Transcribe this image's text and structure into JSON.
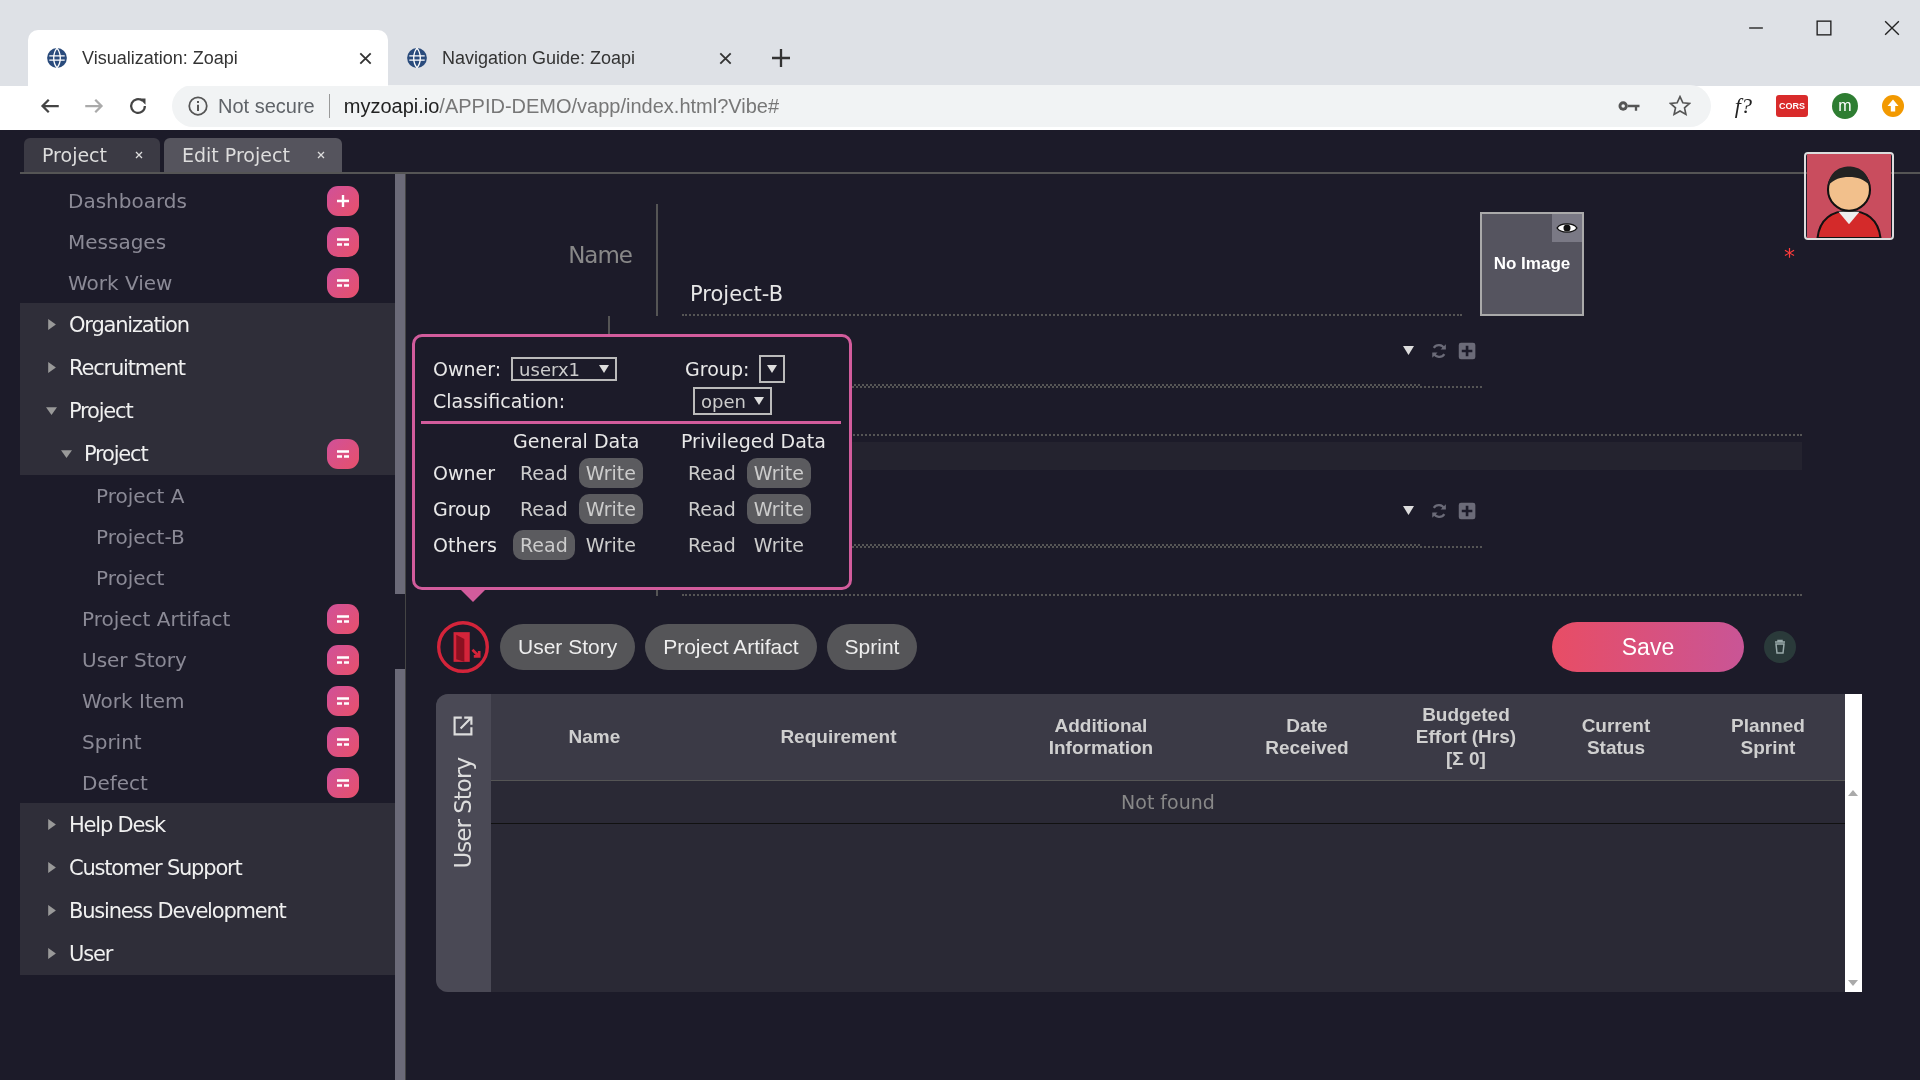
{
  "browser": {
    "tabs": [
      {
        "title": "Visualization: Zoapi",
        "selected": true
      },
      {
        "title": "Navigation Guide: Zoapi",
        "selected": false
      }
    ],
    "security": "Not secure",
    "url_host": "myzoapi.io",
    "url_path": "/APPID-DEMO/vapp/index.html?Vibe#",
    "function_label": "f?",
    "extension_label": "CORS",
    "profile_initial": "m"
  },
  "app_tabs": [
    {
      "label": "Project",
      "selected": false
    },
    {
      "label": "Edit Project",
      "selected": true
    }
  ],
  "sidebar": {
    "items": [
      {
        "kind": "link",
        "label": "Dashboards",
        "button": {
          "kind": "add"
        }
      },
      {
        "kind": "link",
        "label": "Messages",
        "button": {
          "kind": "menu"
        }
      },
      {
        "kind": "link",
        "label": "Work View",
        "button": {
          "kind": "menu"
        }
      },
      {
        "kind": "group",
        "label": "Organization",
        "expanded": false
      },
      {
        "kind": "group",
        "label": "Recruitment",
        "expanded": false
      },
      {
        "kind": "group",
        "label": "Project",
        "expanded": true,
        "children": [
          {
            "kind": "group",
            "label": "Project",
            "expanded": true,
            "button": {
              "kind": "menu"
            },
            "children": [
              {
                "label": "Project A"
              },
              {
                "label": "Project-B"
              },
              {
                "label": "Project"
              }
            ]
          },
          {
            "kind": "link",
            "label": "Project Artifact",
            "button": {
              "kind": "menu"
            }
          },
          {
            "kind": "link",
            "label": "User Story",
            "button": {
              "kind": "menu"
            }
          },
          {
            "kind": "link",
            "label": "Work Item",
            "button": {
              "kind": "menu"
            }
          },
          {
            "kind": "link",
            "label": "Sprint",
            "button": {
              "kind": "menu"
            }
          },
          {
            "kind": "link",
            "label": "Defect",
            "button": {
              "kind": "menu"
            }
          }
        ]
      },
      {
        "kind": "group",
        "label": "Help Desk",
        "expanded": false
      },
      {
        "kind": "group",
        "label": "Customer Support",
        "expanded": false
      },
      {
        "kind": "group",
        "label": "Business Development",
        "expanded": false
      },
      {
        "kind": "group",
        "label": "User",
        "expanded": false
      }
    ]
  },
  "form": {
    "name_label": "Name",
    "name_value": "Project-B",
    "image_label": "No Image",
    "required_mark": "*",
    "rows": [
      {
        "kind": "lookup"
      },
      {
        "kind": "text"
      },
      {
        "kind": "band"
      },
      {
        "kind": "lookup"
      },
      {
        "kind": "text"
      }
    ]
  },
  "permissions_popup": {
    "owner_label": "Owner:",
    "owner_value": "userx1",
    "group_label": "Group:",
    "classification_label": "Classification:",
    "classification_value": "open",
    "headers": [
      "General Data",
      "Privileged Data"
    ],
    "rows": [
      {
        "role": "Owner",
        "general": [
          {
            "label": "Read",
            "on": false
          },
          {
            "label": "Write",
            "on": true
          }
        ],
        "privileged": [
          {
            "label": "Read",
            "on": false
          },
          {
            "label": "Write",
            "on": true
          }
        ]
      },
      {
        "role": "Group",
        "general": [
          {
            "label": "Read",
            "on": false
          },
          {
            "label": "Write",
            "on": true
          }
        ],
        "privileged": [
          {
            "label": "Read",
            "on": false
          },
          {
            "label": "Write",
            "on": true
          }
        ]
      },
      {
        "role": "Others",
        "general": [
          {
            "label": "Read",
            "on": true
          },
          {
            "label": "Write",
            "on": false
          }
        ],
        "privileged": [
          {
            "label": "Read",
            "on": false
          },
          {
            "label": "Write",
            "on": false
          }
        ]
      }
    ]
  },
  "related_tabs": [
    "User Story",
    "Project Artifact",
    "Sprint"
  ],
  "save_label": "Save",
  "table": {
    "side_label": "User Story",
    "columns": [
      "Name",
      "Requirement",
      "Additional Information",
      "Date Received",
      "Budgeted Effort (Hrs) [Σ 0]",
      "Current Status",
      "Planned Sprint"
    ],
    "empty_text": "Not found"
  }
}
